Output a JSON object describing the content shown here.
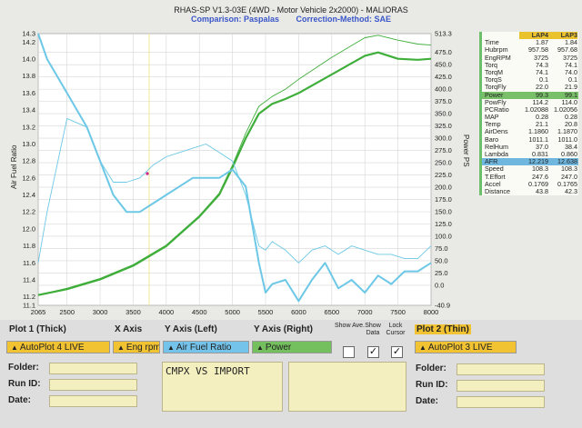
{
  "header": {
    "title": "RHAS-SP V1.3-03E  (4WD - Motor Vehicle 2x2000) - MALIORAS",
    "comparison": "Comparison: Paspalas",
    "correction": "Correction-Method: SAE"
  },
  "chart_data": {
    "type": "line",
    "ylabel": "Air Fuel Ratio",
    "y2label": "Power PS",
    "xlim": [
      2065,
      8000
    ],
    "ylim": [
      11.1,
      14.3
    ],
    "y2lim": [
      -40.9,
      513.3
    ],
    "x_ticks": [
      "2065",
      "2500",
      "3000",
      "3500",
      "4000",
      "4500",
      "5000",
      "5500",
      "6000",
      "6500",
      "7000",
      "7500",
      "8000"
    ],
    "y_ticks": [
      "14.3",
      "14.2",
      "14.0",
      "13.8",
      "13.6",
      "13.4",
      "13.2",
      "13.0",
      "12.8",
      "12.6",
      "12.4",
      "12.2",
      "12.0",
      "11.8",
      "11.6",
      "11.4",
      "11.2",
      "11.1"
    ],
    "y2_ticks": [
      "513.3",
      "475.0",
      "450.0",
      "425.0",
      "400.0",
      "375.0",
      "350.0",
      "325.0",
      "300.0",
      "275.0",
      "250.0",
      "225.0",
      "200.0",
      "175.0",
      "150.0",
      "125.0",
      "100.0",
      "75.0",
      "50.0",
      "25.0",
      "0.0",
      "-40.9"
    ],
    "series": [
      {
        "axis": "right",
        "color": "#3fae3a",
        "width": 2.2,
        "x": [
          2065,
          2500,
          3000,
          3500,
          4000,
          4500,
          4800,
          5000,
          5200,
          5400,
          5600,
          5800,
          6000,
          6500,
          7000,
          7200,
          7500,
          7800,
          8000
        ],
        "values": [
          -20,
          -8,
          12,
          40,
          80,
          140,
          185,
          240,
          300,
          350,
          370,
          380,
          392,
          430,
          468,
          475,
          462,
          460,
          462
        ]
      },
      {
        "axis": "right",
        "color": "#3fae3a",
        "width": 0.9,
        "x": [
          2065,
          2500,
          3000,
          3500,
          4000,
          4500,
          4800,
          5000,
          5200,
          5400,
          5600,
          5800,
          6000,
          6500,
          7000,
          7200,
          7500,
          7800,
          8000
        ],
        "values": [
          -20,
          -6,
          14,
          42,
          82,
          142,
          188,
          245,
          310,
          365,
          385,
          400,
          420,
          465,
          505,
          510,
          500,
          492,
          490
        ]
      },
      {
        "axis": "left",
        "color": "#6cc8e6",
        "width": 2.0,
        "x": [
          2065,
          2200,
          2500,
          2800,
          3000,
          3200,
          3400,
          3600,
          3800,
          4000,
          4200,
          4400,
          4600,
          4800,
          5000,
          5200,
          5400,
          5500,
          5600,
          5800,
          6000,
          6200,
          6400,
          6600,
          6800,
          7000,
          7200,
          7400,
          7600,
          7800,
          8000
        ],
        "values": [
          14.3,
          14.0,
          13.6,
          13.2,
          12.8,
          12.4,
          12.2,
          12.2,
          12.3,
          12.4,
          12.5,
          12.6,
          12.6,
          12.6,
          12.7,
          12.5,
          11.6,
          11.25,
          11.35,
          11.4,
          11.15,
          11.4,
          11.6,
          11.3,
          11.4,
          11.25,
          11.45,
          11.35,
          11.5,
          11.5,
          11.6
        ]
      },
      {
        "axis": "left",
        "color": "#6cc8e6",
        "width": 0.9,
        "x": [
          2065,
          2200,
          2500,
          2800,
          3000,
          3200,
          3400,
          3600,
          3800,
          4000,
          4200,
          4400,
          4600,
          4800,
          5000,
          5200,
          5400,
          5500,
          5600,
          5800,
          6000,
          6200,
          6400,
          6600,
          6800,
          7000,
          7200,
          7400,
          7600,
          7800,
          8000
        ],
        "values": [
          11.6,
          12.2,
          13.3,
          13.2,
          12.8,
          12.55,
          12.55,
          12.6,
          12.75,
          12.85,
          12.9,
          12.95,
          13.0,
          12.9,
          12.8,
          12.4,
          11.8,
          11.75,
          11.85,
          11.75,
          11.6,
          11.75,
          11.8,
          11.7,
          11.8,
          11.75,
          11.7,
          11.7,
          11.65,
          11.65,
          11.8
        ]
      }
    ]
  },
  "panel": {
    "lap_a": "LAP4",
    "lap_b": "LAP3",
    "rows": [
      {
        "name": "Time",
        "a": "1.87",
        "b": "1.84"
      },
      {
        "name": "Hubrpm",
        "a": "957.58",
        "b": "957.68"
      },
      {
        "name": "EngRPM",
        "a": "3725",
        "b": "3725"
      },
      {
        "name": "Torq",
        "a": "74.3",
        "b": "74.1"
      },
      {
        "name": "TorqM",
        "a": "74.1",
        "b": "74.0"
      },
      {
        "name": "TorqS",
        "a": "0.1",
        "b": "0.1"
      },
      {
        "name": "TorqFly",
        "a": "22.0",
        "b": "21.9"
      },
      {
        "name": "Power",
        "a": "99.3",
        "b": "99.1"
      },
      {
        "name": "PowFly",
        "a": "114.2",
        "b": "114.0"
      },
      {
        "name": "PCRatio",
        "a": "1.02088",
        "b": "1.02056"
      },
      {
        "name": "MAP",
        "a": "0.28",
        "b": "0.28"
      },
      {
        "name": "Temp",
        "a": "21.1",
        "b": "20.8"
      },
      {
        "name": "AirDens",
        "a": "1.1860",
        "b": "1.1870"
      },
      {
        "name": "Baro",
        "a": "1011.1",
        "b": "1011.0"
      },
      {
        "name": "RelHum",
        "a": "37.0",
        "b": "38.4"
      },
      {
        "name": "Lambda",
        "a": "0.831",
        "b": "0.860"
      },
      {
        "name": "AFR",
        "a": "12.219",
        "b": "12.638"
      },
      {
        "name": "Speed",
        "a": "108.3",
        "b": "108.3"
      },
      {
        "name": "T.Effort",
        "a": "247.6",
        "b": "247.0"
      },
      {
        "name": "Accel",
        "a": "0.1769",
        "b": "0.1765"
      },
      {
        "name": "Distance",
        "a": "43.8",
        "b": "42.3"
      }
    ]
  },
  "controls": {
    "plot1_label": "Plot 1 (Thick)",
    "xaxis_label": "X Axis",
    "yleft_label": "Y Axis (Left)",
    "yright_label": "Y Axis (Right)",
    "show_ave": "Show Ave.",
    "show_data": "Show Data",
    "lock_cursor": "Lock Cursor",
    "plot2_label": "Plot 2 (Thin)",
    "plot1_value": "AutoPlot 4 LIVE",
    "xaxis_value": "Eng rpm",
    "yleft_value": "Air Fuel Ratio",
    "yright_value": "Power",
    "plot2_value": "AutoPlot 3 LIVE",
    "folder_label": "Folder:",
    "runid_label": "Run ID:",
    "date_label": "Date:",
    "folder2_label": "Folder:",
    "runid2_label": "Run ID:",
    "date2_label": "Date:",
    "note": "CMPX VS IMPORT",
    "show_ave_checked": false,
    "show_data_checked": true,
    "lock_cursor_checked": true
  },
  "colors": {
    "plot1_select": "#f1c232",
    "plot2_select": "#f1c232",
    "yleft_select": "#74c3ea",
    "yright_select": "#74bf5e",
    "power_line": "#3fae3a",
    "afr_line": "#6cc8e6"
  }
}
